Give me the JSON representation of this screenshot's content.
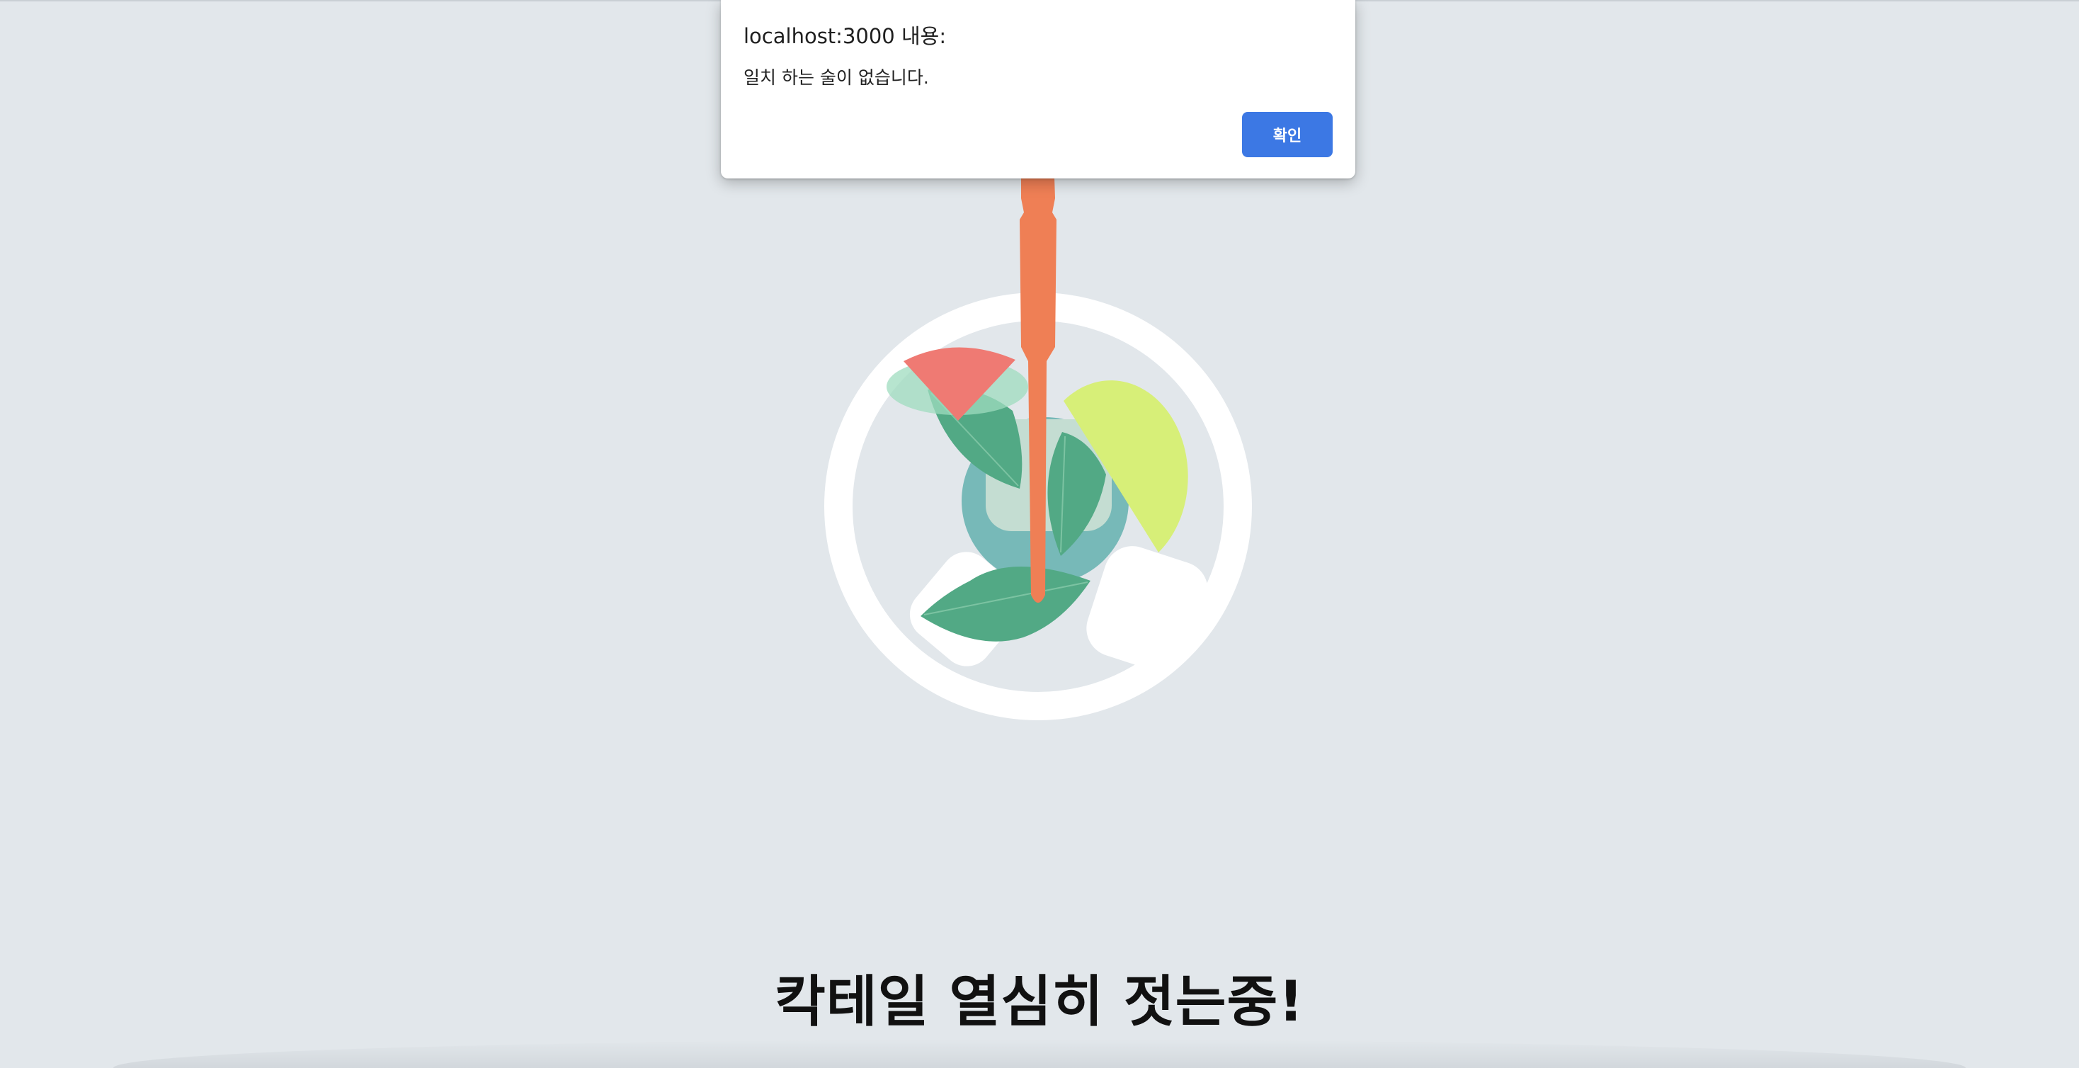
{
  "dialog": {
    "title": "localhost:3000 내용:",
    "message": "일치 하는 술이 없습니다.",
    "confirm_label": "확인"
  },
  "main": {
    "headline": "칵테일 열심히 젓는중!"
  },
  "illustration": {
    "subject": "cocktail-glass-stirring-icon",
    "colors": {
      "background": "#e2e7eb",
      "glass_rim": "#ffffff",
      "stirrer": "#ef7f55",
      "leaf": "#52a985",
      "lime": "#d7ef78",
      "grapefruit": "#ef7a73",
      "liquid": "#77b9b8",
      "ice": "#ffffff"
    }
  },
  "theme": {
    "button_color": "#3c78e4"
  }
}
